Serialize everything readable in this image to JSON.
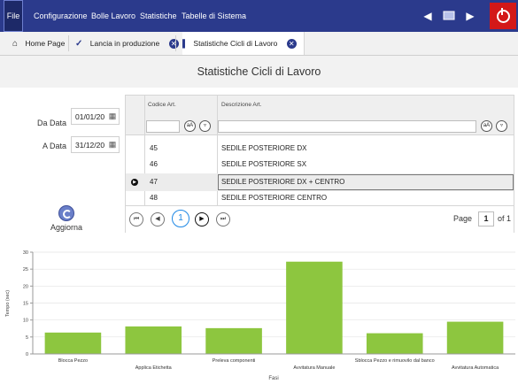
{
  "menu": {
    "file": "File",
    "items": [
      "Configurazione",
      "Bolle Lavoro",
      "Statistiche",
      "Tabelle di Sistema"
    ]
  },
  "tabs": [
    {
      "label": "Home Page",
      "icon": "home-icon"
    },
    {
      "label": "Lancia in produzione",
      "icon": "check-icon"
    },
    {
      "label": "Statistiche Cicli di Lavoro",
      "icon": "bar-chart-icon"
    }
  ],
  "page_title": "Statistiche Cicli di Lavoro",
  "filters": {
    "da_data_label": "Da Data",
    "da_data_value": "01/01/20",
    "a_data_label": "A Data",
    "a_data_value": "31/12/20"
  },
  "refresh_label": "Aggiorna",
  "grid": {
    "columns": [
      "Codice Art.",
      "Descrizione Art."
    ],
    "rows": [
      {
        "code": "45",
        "desc": "SEDILE POSTERIORE DX"
      },
      {
        "code": "46",
        "desc": "SEDILE POSTERIORE SX"
      },
      {
        "code": "47",
        "desc": "SEDILE POSTERIORE DX + CENTRO"
      },
      {
        "code": "48",
        "desc": "SEDILE POSTERIORE CENTRO"
      }
    ],
    "selected_index": 2,
    "pager": {
      "current": "1",
      "page_label": "Page",
      "page_value": "1",
      "of_label": "of 1"
    }
  },
  "colors": {
    "topbar": "#2b3a8c",
    "bar": "#8dc63f",
    "power": "#d31818",
    "accent": "#1e88e5"
  },
  "chart_data": {
    "type": "bar",
    "categories": [
      "Blocca Pezzo",
      "Applica Etichetta",
      "Preleva componenti",
      "Avvitatura Manuale",
      "Sblocca Pezzo e  rimuovilo dal banco",
      "Avvitatura Automatica"
    ],
    "values": [
      6.3,
      8.1,
      7.6,
      27.2,
      6.1,
      9.5
    ],
    "xlabel": "Fasi",
    "ylabel": "Tempo (sec)",
    "ylim": [
      0,
      30
    ],
    "yticks": [
      0,
      5,
      10,
      15,
      20,
      25,
      30
    ],
    "grid": true
  }
}
